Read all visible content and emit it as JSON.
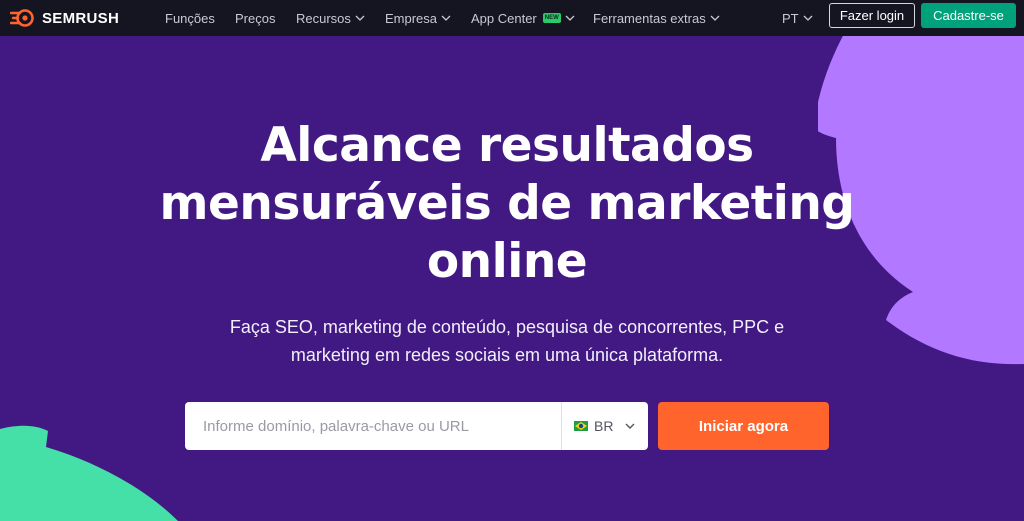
{
  "brand": {
    "name": "SEMRUSH",
    "logo_icon": "semrush-flame-icon"
  },
  "nav": {
    "items": [
      {
        "label": "Funções",
        "has_dropdown": false
      },
      {
        "label": "Preços",
        "has_dropdown": false
      },
      {
        "label": "Recursos",
        "has_dropdown": true
      },
      {
        "label": "Empresa",
        "has_dropdown": true
      },
      {
        "label": "App Center",
        "has_dropdown": true,
        "badge": "NEW"
      },
      {
        "label": "Ferramentas extras",
        "has_dropdown": true
      }
    ],
    "language": "PT",
    "login_label": "Fazer login",
    "signup_label": "Cadastre-se"
  },
  "hero": {
    "title_lines": [
      "Alcance resultados",
      "mensuráveis de marketing",
      "online"
    ],
    "subtitle_lines": [
      "Faça SEO, marketing de conteúdo, pesquisa de concorrentes, PPC e",
      "marketing em redes sociais em uma única plataforma."
    ]
  },
  "search": {
    "placeholder": "Informe domínio, palavra-chave ou URL",
    "value": "",
    "country": "BR",
    "country_flag_icon": "brazil-flag-icon",
    "submit_label": "Iniciar agora"
  },
  "colors": {
    "nav_bg": "#151522",
    "hero_bg": "#421983",
    "accent_orange": "#ff642d",
    "signup_green": "#00a27b",
    "deco_purple": "#b278ff",
    "deco_green": "#45e0a8"
  }
}
